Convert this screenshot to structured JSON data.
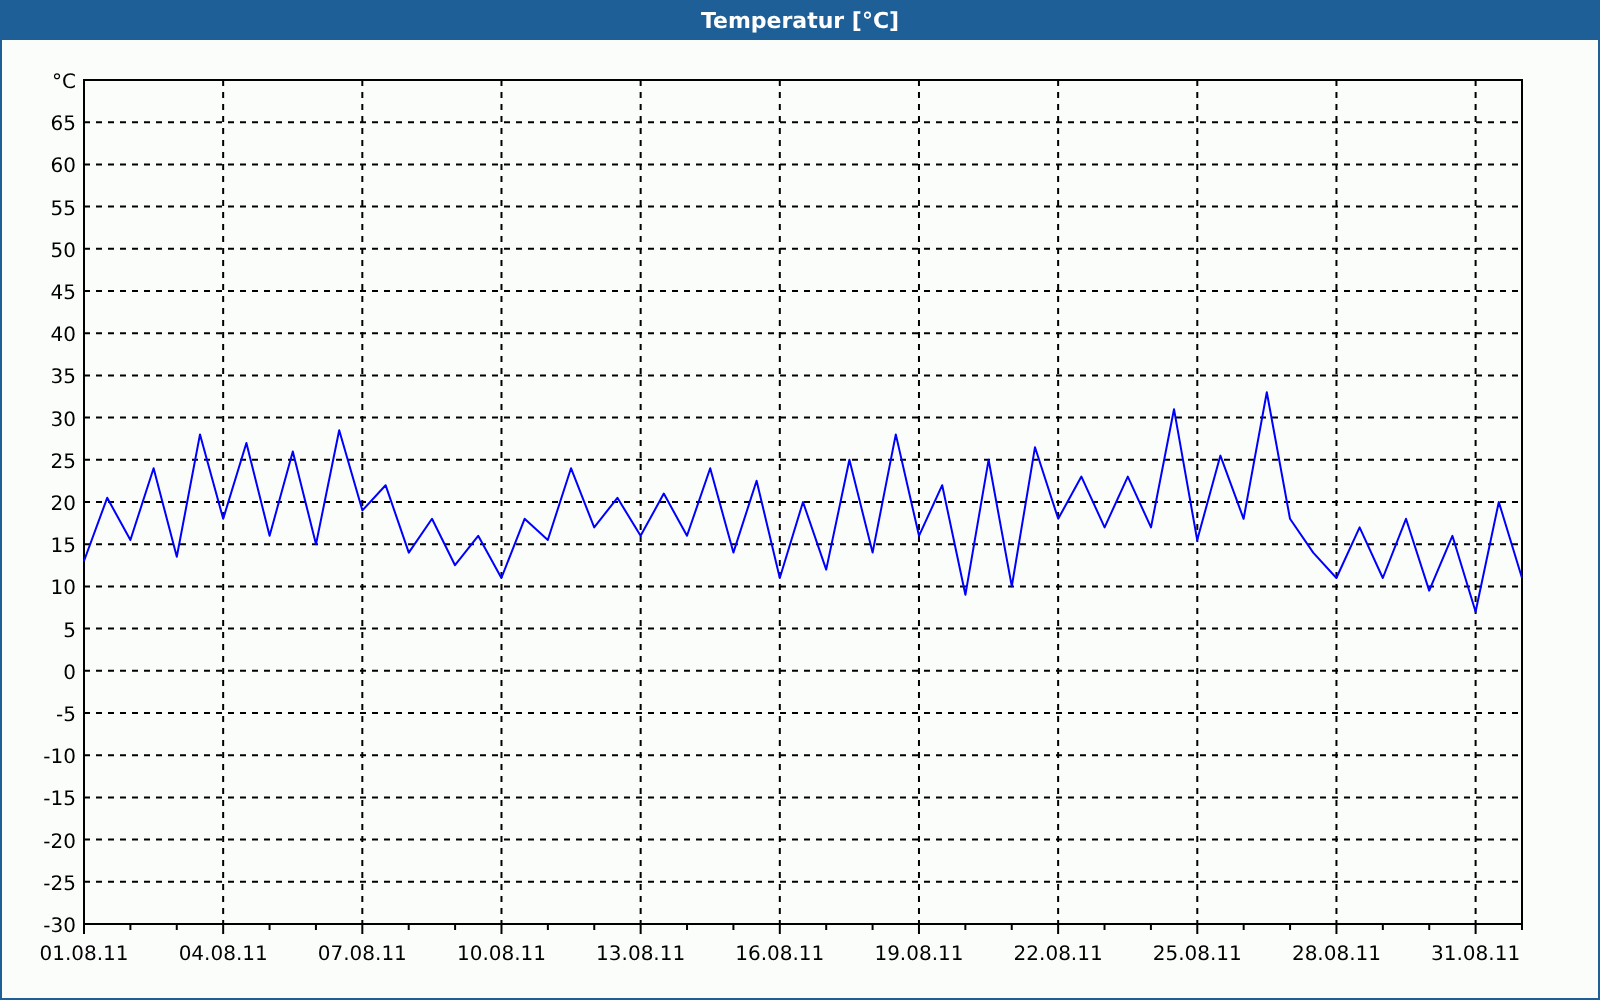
{
  "window": {
    "title": "Temperatur [°C]"
  },
  "chart": {
    "chart_data": {
      "type": "line",
      "categories": [
        "01.08.11",
        null,
        null,
        null,
        null,
        null,
        "04.08.11",
        null,
        null,
        null,
        null,
        null,
        "07.08.11",
        null,
        null,
        null,
        null,
        null,
        "10.08.11",
        null,
        null,
        null,
        null,
        null,
        "13.08.11",
        null,
        null,
        null,
        null,
        null,
        "16.08.11",
        null,
        null,
        null,
        null,
        null,
        "19.08.11",
        null,
        null,
        null,
        null,
        null,
        "22.08.11",
        null,
        null,
        null,
        null,
        null,
        "25.08.11",
        null,
        null,
        null,
        null,
        null,
        "28.08.11",
        null,
        null,
        null,
        null,
        null,
        "31.08.11",
        null,
        null
      ],
      "series": [
        {
          "color": "#0000ff",
          "values": [
            13,
            20.5,
            15.5,
            24,
            13.5,
            28,
            18,
            27,
            16,
            26,
            15,
            28.5,
            19,
            22,
            14,
            18,
            12.5,
            16,
            11,
            18,
            15.5,
            24,
            17,
            20.5,
            16,
            21,
            16,
            24,
            14,
            22.5,
            11,
            20,
            12,
            25,
            14,
            28,
            16,
            22,
            9,
            25,
            10,
            26.5,
            18,
            23,
            17,
            23,
            17,
            31,
            15.5,
            25.5,
            18,
            33,
            18,
            14,
            11,
            17,
            11,
            18,
            9.5,
            16,
            7,
            20,
            11
          ]
        }
      ],
      "grid": true,
      "ylim": [
        -30,
        70
      ],
      "yticks": [
        -30,
        -25,
        -20,
        -15,
        -10,
        -5,
        0,
        5,
        10,
        15,
        20,
        25,
        30,
        35,
        40,
        45,
        50,
        55,
        60,
        65,
        {
          "value": 70,
          "label": "°C"
        }
      ]
    }
  }
}
